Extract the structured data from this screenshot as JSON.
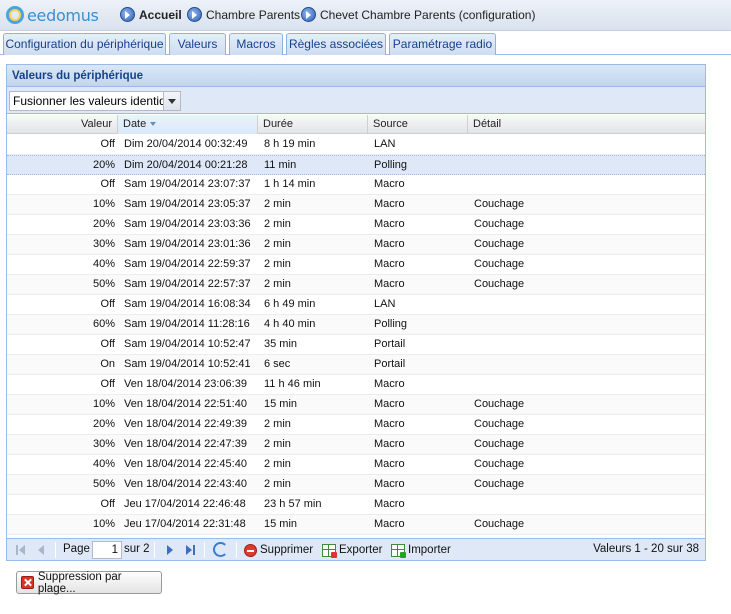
{
  "header": {
    "logo_text": "eedomus",
    "breadcrumbs": [
      {
        "label": "Accueil"
      },
      {
        "label": "Chambre Parents"
      },
      {
        "label": "Chevet Chambre Parents (configuration)"
      }
    ]
  },
  "tabs": [
    {
      "label": "Configuration du périphérique"
    },
    {
      "label": "Valeurs"
    },
    {
      "label": "Macros"
    },
    {
      "label": "Règles associées"
    },
    {
      "label": "Paramétrage radio"
    }
  ],
  "panel": {
    "title": "Valeurs du périphérique",
    "merge_select": {
      "value": "Fusionner les valeurs identiques"
    }
  },
  "grid": {
    "columns": {
      "value": "Valeur",
      "date": "Date",
      "duration": "Durée",
      "source": "Source",
      "detail": "Détail"
    },
    "sorted_column": "date",
    "selected_row_index": 1,
    "rows": [
      {
        "value": "Off",
        "date": "Dim 20/04/2014 00:32:49",
        "duration": "8 h 19 min",
        "source": "LAN",
        "detail": ""
      },
      {
        "value": "20%",
        "date": "Dim 20/04/2014 00:21:28",
        "duration": "11 min",
        "source": "Polling",
        "detail": ""
      },
      {
        "value": "Off",
        "date": "Sam 19/04/2014 23:07:37",
        "duration": "1 h 14 min",
        "source": "Macro",
        "detail": ""
      },
      {
        "value": "10%",
        "date": "Sam 19/04/2014 23:05:37",
        "duration": "2 min",
        "source": "Macro",
        "detail": "Couchage"
      },
      {
        "value": "20%",
        "date": "Sam 19/04/2014 23:03:36",
        "duration": "2 min",
        "source": "Macro",
        "detail": "Couchage"
      },
      {
        "value": "30%",
        "date": "Sam 19/04/2014 23:01:36",
        "duration": "2 min",
        "source": "Macro",
        "detail": "Couchage"
      },
      {
        "value": "40%",
        "date": "Sam 19/04/2014 22:59:37",
        "duration": "2 min",
        "source": "Macro",
        "detail": "Couchage"
      },
      {
        "value": "50%",
        "date": "Sam 19/04/2014 22:57:37",
        "duration": "2 min",
        "source": "Macro",
        "detail": "Couchage"
      },
      {
        "value": "Off",
        "date": "Sam 19/04/2014 16:08:34",
        "duration": "6 h 49 min",
        "source": "LAN",
        "detail": ""
      },
      {
        "value": "60%",
        "date": "Sam 19/04/2014 11:28:16",
        "duration": "4 h 40 min",
        "source": "Polling",
        "detail": ""
      },
      {
        "value": "Off",
        "date": "Sam 19/04/2014 10:52:47",
        "duration": "35 min",
        "source": "Portail",
        "detail": ""
      },
      {
        "value": "On",
        "date": "Sam 19/04/2014 10:52:41",
        "duration": "6 sec",
        "source": "Portail",
        "detail": ""
      },
      {
        "value": "Off",
        "date": "Ven 18/04/2014 23:06:39",
        "duration": "11 h 46 min",
        "source": "Macro",
        "detail": ""
      },
      {
        "value": "10%",
        "date": "Ven 18/04/2014 22:51:40",
        "duration": "15 min",
        "source": "Macro",
        "detail": "Couchage"
      },
      {
        "value": "20%",
        "date": "Ven 18/04/2014 22:49:39",
        "duration": "2 min",
        "source": "Macro",
        "detail": "Couchage"
      },
      {
        "value": "30%",
        "date": "Ven 18/04/2014 22:47:39",
        "duration": "2 min",
        "source": "Macro",
        "detail": "Couchage"
      },
      {
        "value": "40%",
        "date": "Ven 18/04/2014 22:45:40",
        "duration": "2 min",
        "source": "Macro",
        "detail": "Couchage"
      },
      {
        "value": "50%",
        "date": "Ven 18/04/2014 22:43:40",
        "duration": "2 min",
        "source": "Macro",
        "detail": "Couchage"
      },
      {
        "value": "Off",
        "date": "Jeu 17/04/2014 22:46:48",
        "duration": "23 h 57 min",
        "source": "Macro",
        "detail": ""
      },
      {
        "value": "10%",
        "date": "Jeu 17/04/2014 22:31:48",
        "duration": "15 min",
        "source": "Macro",
        "detail": "Couchage"
      }
    ]
  },
  "pager": {
    "page_label": "Page",
    "current_page": "1",
    "of_label": "sur 2",
    "delete_label": "Supprimer",
    "export_label": "Exporter",
    "import_label": "Importer",
    "info": "Valeurs 1 - 20 sur 38"
  },
  "range_delete_button": {
    "label": "Suppression par plage..."
  },
  "colors": {
    "header_text": "#15428b",
    "selected_row": "#dfe8f6",
    "panel_border": "#99bbe8"
  },
  "icons": [
    "home-icon",
    "nav-arrow-icon",
    "first-page-icon",
    "prev-page-icon",
    "next-page-icon",
    "last-page-icon",
    "refresh-icon",
    "delete-icon",
    "export-excel-icon",
    "import-excel-icon",
    "close-red-icon"
  ]
}
